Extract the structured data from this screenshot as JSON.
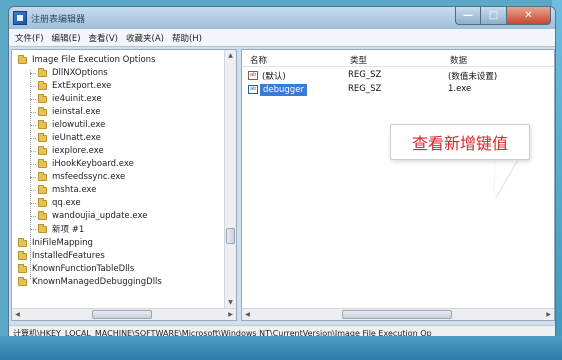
{
  "window": {
    "title": "注册表编辑器",
    "controls": {
      "minimize": "—",
      "maximize": "□",
      "close": "✕"
    }
  },
  "menu": [
    "文件(F)",
    "编辑(E)",
    "查看(V)",
    "收藏夹(A)",
    "帮助(H)"
  ],
  "tree": {
    "root": "Image File Execution Options",
    "children": [
      "DllNXOptions",
      "ExtExport.exe",
      "ie4uinit.exe",
      "ieinstal.exe",
      "ielowutil.exe",
      "ieUnatt.exe",
      "iexplore.exe",
      "iHookKeyboard.exe",
      "msfeedssync.exe",
      "mshta.exe",
      "qq.exe",
      "wandoujia_update.exe",
      "新项 #1"
    ],
    "siblings": [
      "IniFileMapping",
      "InstalledFeatures",
      "KnownFunctionTableDlls",
      "KnownManagedDebuggingDlls"
    ]
  },
  "list": {
    "columns": [
      "名称",
      "类型",
      "数据"
    ],
    "rows": [
      {
        "icon": "ab",
        "name": "(默认)",
        "type": "REG_SZ",
        "data": "(数值未设置)",
        "selected": false
      },
      {
        "icon": "ab",
        "name": "debugger",
        "type": "REG_SZ",
        "data": "1.exe",
        "selected": true
      }
    ]
  },
  "callout": "查看新增键值",
  "statusbar": "计算机\\HKEY_LOCAL_MACHINE\\SOFTWARE\\Microsoft\\Windows NT\\CurrentVersion\\Image File Execution Op",
  "scroll": {
    "up": "▲",
    "down": "▼",
    "left": "◀",
    "right": "▶"
  }
}
